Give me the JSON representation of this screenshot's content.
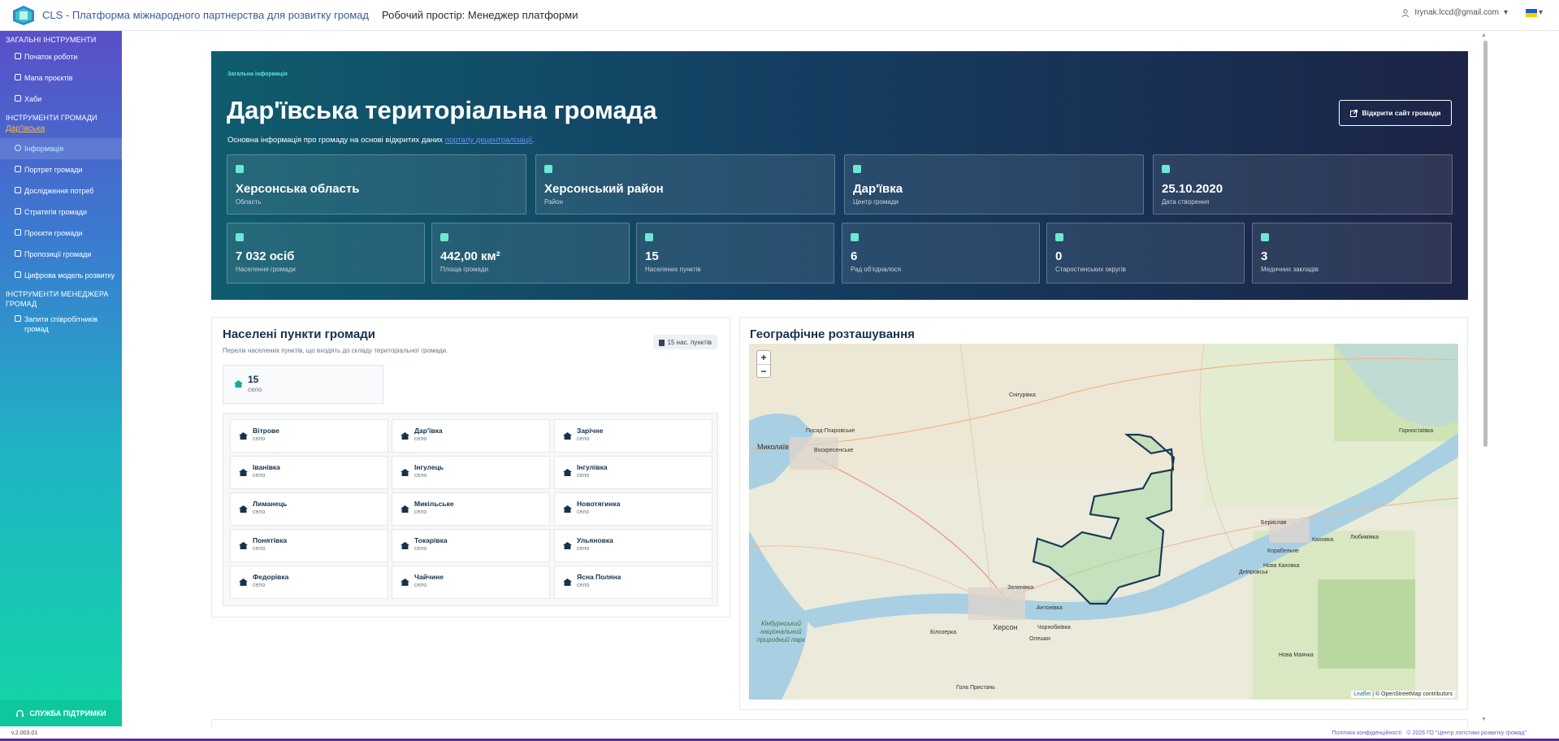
{
  "topbar": {
    "brand": "CLS - Платформа міжнародного партнерства для розвитку громад",
    "workspace": "Робочий простір: Менеджер платформи",
    "user_email": "Irynak.lccd@gmail.com"
  },
  "sidebar": {
    "section_general": "ЗАГАЛЬНІ ІНСТРУМЕНТИ",
    "general_items": [
      {
        "label": "Початок роботи",
        "icon": "home-icon"
      },
      {
        "label": "Мапа проєктів",
        "icon": "map-icon"
      },
      {
        "label": "Хаби",
        "icon": "hub-icon"
      }
    ],
    "section_community": "ІНСТРУМЕНТИ ГРОМАДИ",
    "community_link": "Дар'ївська",
    "community_items": [
      {
        "label": "Інформація",
        "icon": "info-icon",
        "active": true
      },
      {
        "label": "Портрет громади",
        "icon": "portrait-icon"
      },
      {
        "label": "Дослідження потреб",
        "icon": "research-icon"
      },
      {
        "label": "Стратегія громади",
        "icon": "chart-icon"
      },
      {
        "label": "Проєкти громади",
        "icon": "briefcase-icon"
      },
      {
        "label": "Пропозиції громади",
        "icon": "document-icon"
      },
      {
        "label": "Цифрова модель розвитку",
        "icon": "model-icon"
      }
    ],
    "section_manager": "ІНСТРУМЕНТИ МЕНЕДЖЕРА ГРОМАД",
    "manager_items": [
      {
        "label": "Запити співробітників громад",
        "icon": "users-icon"
      }
    ],
    "support": "СЛУЖБА ПІДТРИМКИ"
  },
  "hero": {
    "eyebrow": "Загальна інформація",
    "title": "Дар'ївська територіальна громада",
    "subtitle_prefix": "Основна інформація про громаду на основі відкритих даних ",
    "subtitle_link": "порталу децентралізації",
    "subtitle_suffix": ".",
    "open_button": "Відкрити сайт громади",
    "cards_top": [
      {
        "value": "Херсонська область",
        "label": "Область",
        "icon": "map-icon"
      },
      {
        "value": "Херсонський район",
        "label": "Район",
        "icon": "district-icon"
      },
      {
        "value": "Дар'ївка",
        "label": "Центр громади",
        "icon": "city-icon"
      },
      {
        "value": "25.10.2020",
        "label": "Дата створення",
        "icon": "calendar-icon"
      }
    ],
    "cards_bottom": [
      {
        "value": "7 032 осіб",
        "label": "Населення громади",
        "icon": "people-icon"
      },
      {
        "value": "442,00 км²",
        "label": "Площа громади",
        "icon": "area-icon"
      },
      {
        "value": "15",
        "label": "Населених пунктів",
        "icon": "buildings-icon"
      },
      {
        "value": "6",
        "label": "Рад об'єдналося",
        "icon": "council-icon"
      },
      {
        "value": "0",
        "label": "Старостинських округів",
        "icon": "group-icon"
      },
      {
        "value": "3",
        "label": "Медичних закладів",
        "icon": "medical-icon"
      }
    ]
  },
  "settlements": {
    "title": "Населені пункти громади",
    "description": "Перелік населених пунктів, що входять до складу територіальної громади.",
    "badge": "15 нас. пунктів",
    "summary_count": "15",
    "summary_label": "село",
    "items": [
      {
        "name": "Вітрове",
        "type": "село"
      },
      {
        "name": "Дар'ївка",
        "type": "село"
      },
      {
        "name": "Зарічне",
        "type": "село"
      },
      {
        "name": "Іванівка",
        "type": "село"
      },
      {
        "name": "Інгулець",
        "type": "село"
      },
      {
        "name": "Інгулівка",
        "type": "село"
      },
      {
        "name": "Лиманець",
        "type": "село"
      },
      {
        "name": "Микільське",
        "type": "село"
      },
      {
        "name": "Новотягинка",
        "type": "село"
      },
      {
        "name": "Понятівка",
        "type": "село"
      },
      {
        "name": "Токарівка",
        "type": "село"
      },
      {
        "name": "Ульяновка",
        "type": "село"
      },
      {
        "name": "Федорівка",
        "type": "село"
      },
      {
        "name": "Чайчине",
        "type": "село"
      },
      {
        "name": "Ясна Поляна",
        "type": "село"
      }
    ]
  },
  "map": {
    "title": "Географічне розташування",
    "zoom_in": "+",
    "zoom_out": "−",
    "attribution_link": "Leaflet",
    "attribution_text": " | © OpenStreetMap contributors",
    "labels": [
      "Миколаїв",
      "Херсон",
      "Снігурівка",
      "Берислав",
      "Нова Каховка",
      "Каховка",
      "Горностаївка",
      "Любимівка",
      "Олешки",
      "Гола Пристань",
      "Антонівка",
      "Чорнобаївка",
      "Білозерка",
      "Посад-Покровське",
      "Зеленівка",
      "Дніпровськ",
      "Корабельне",
      "Нова Маячка",
      "Воскресенське"
    ],
    "park_label": "Кінбурнський національний природний парк"
  },
  "footer": {
    "version": "v.2.003.01",
    "privacy": "Політика конфіденційності",
    "copyright": "© 2026 ГО \"Центр логістики розвитку громад\""
  }
}
